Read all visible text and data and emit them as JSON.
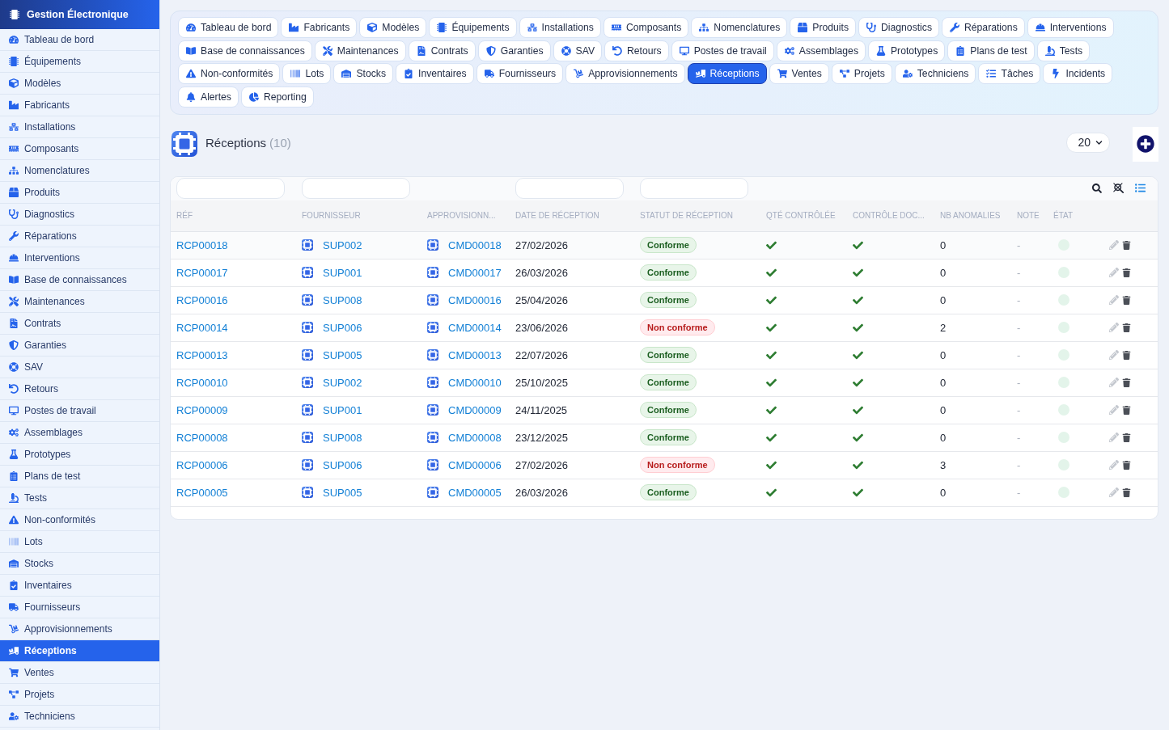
{
  "sidebar": {
    "title": "Gestion Électronique",
    "items": [
      {
        "label": "Tableau de bord",
        "selected": false
      },
      {
        "label": "Équipements",
        "selected": false
      },
      {
        "label": "Modèles",
        "selected": false
      },
      {
        "label": "Fabricants",
        "selected": false
      },
      {
        "label": "Installations",
        "selected": false
      },
      {
        "label": "Composants",
        "selected": false
      },
      {
        "label": "Nomenclatures",
        "selected": false
      },
      {
        "label": "Produits",
        "selected": false
      },
      {
        "label": "Diagnostics",
        "selected": false
      },
      {
        "label": "Réparations",
        "selected": false
      },
      {
        "label": "Interventions",
        "selected": false
      },
      {
        "label": "Base de connaissances",
        "selected": false
      },
      {
        "label": "Maintenances",
        "selected": false
      },
      {
        "label": "Contrats",
        "selected": false
      },
      {
        "label": "Garanties",
        "selected": false
      },
      {
        "label": "SAV",
        "selected": false
      },
      {
        "label": "Retours",
        "selected": false
      },
      {
        "label": "Postes de travail",
        "selected": false
      },
      {
        "label": "Assemblages",
        "selected": false
      },
      {
        "label": "Prototypes",
        "selected": false
      },
      {
        "label": "Plans de test",
        "selected": false
      },
      {
        "label": "Tests",
        "selected": false
      },
      {
        "label": "Non-conformités",
        "selected": false
      },
      {
        "label": "Lots",
        "selected": false
      },
      {
        "label": "Stocks",
        "selected": false
      },
      {
        "label": "Inventaires",
        "selected": false
      },
      {
        "label": "Fournisseurs",
        "selected": false
      },
      {
        "label": "Approvisionnements",
        "selected": false
      },
      {
        "label": "Réceptions",
        "selected": true
      },
      {
        "label": "Ventes",
        "selected": false
      },
      {
        "label": "Projets",
        "selected": false
      },
      {
        "label": "Techniciens",
        "selected": false
      }
    ]
  },
  "tabs": {
    "rows": [
      [
        {
          "label": "Tableau de bord",
          "selected": false
        },
        {
          "label": "Fabricants",
          "selected": false
        },
        {
          "label": "Modèles",
          "selected": false
        },
        {
          "label": "Équipements",
          "selected": false
        },
        {
          "label": "Installations",
          "selected": false
        },
        {
          "label": "Composants",
          "selected": false
        },
        {
          "label": "Nomenclatures",
          "selected": false
        },
        {
          "label": "Produits",
          "selected": false
        },
        {
          "label": "Diagnostics",
          "selected": false
        },
        {
          "label": "Réparations",
          "selected": false
        },
        {
          "label": "Interventions",
          "selected": false
        }
      ],
      [
        {
          "label": "Base de connaissances",
          "selected": false
        },
        {
          "label": "Maintenances",
          "selected": false
        },
        {
          "label": "Contrats",
          "selected": false
        },
        {
          "label": "Garanties",
          "selected": false
        },
        {
          "label": "SAV",
          "selected": false
        },
        {
          "label": "Retours",
          "selected": false
        },
        {
          "label": "Postes de travail",
          "selected": false
        },
        {
          "label": "Assemblages",
          "selected": false
        },
        {
          "label": "Prototypes",
          "selected": false
        },
        {
          "label": "Plans de test",
          "selected": false
        },
        {
          "label": "Tests",
          "selected": false
        }
      ],
      [
        {
          "label": "Non-conformités",
          "selected": false
        },
        {
          "label": "Lots",
          "selected": false
        },
        {
          "label": "Stocks",
          "selected": false
        },
        {
          "label": "Inventaires",
          "selected": false
        },
        {
          "label": "Fournisseurs",
          "selected": false
        },
        {
          "label": "Approvisionnements",
          "selected": false
        },
        {
          "label": "Réceptions",
          "selected": true
        },
        {
          "label": "Ventes",
          "selected": false
        },
        {
          "label": "Projets",
          "selected": false
        },
        {
          "label": "Techniciens",
          "selected": false
        },
        {
          "label": "Tâches",
          "selected": false
        },
        {
          "label": "Incidents",
          "selected": false
        }
      ],
      [
        {
          "label": "Alertes",
          "selected": false
        },
        {
          "label": "Reporting",
          "selected": false
        }
      ]
    ]
  },
  "page": {
    "title": "Réceptions",
    "count": "(10)",
    "page_size": "20"
  },
  "table": {
    "columns": [
      {
        "label": "RÉF",
        "filter": true
      },
      {
        "label": "FOURNISSEUR",
        "filter": true
      },
      {
        "label": "APPROVISIONN...",
        "filter": false
      },
      {
        "label": "DATE DE RÉCEPTION",
        "filter": true
      },
      {
        "label": "STATUT DE RÉCEPTION",
        "filter": true
      },
      {
        "label": "QTÉ CONTRÔLÉE",
        "filter": false
      },
      {
        "label": "CONTRÔLE DOC...",
        "filter": false
      },
      {
        "label": "NB ANOMALIES",
        "filter": false
      },
      {
        "label": "NOTE",
        "filter": false
      },
      {
        "label": "ÉTAT",
        "filter": false
      }
    ],
    "rows": [
      {
        "ref": "RCP00018",
        "supplier": "SUP002",
        "order": "CMD00018",
        "date": "27/02/2026",
        "status": {
          "label": "Conforme",
          "kind": "ok"
        },
        "qty_checked": true,
        "doc_checked": true,
        "anomalies": "0",
        "note": "-"
      },
      {
        "ref": "RCP00017",
        "supplier": "SUP001",
        "order": "CMD00017",
        "date": "26/03/2026",
        "status": {
          "label": "Conforme",
          "kind": "ok"
        },
        "qty_checked": true,
        "doc_checked": true,
        "anomalies": "0",
        "note": "-"
      },
      {
        "ref": "RCP00016",
        "supplier": "SUP008",
        "order": "CMD00016",
        "date": "25/04/2026",
        "status": {
          "label": "Conforme",
          "kind": "ok"
        },
        "qty_checked": true,
        "doc_checked": true,
        "anomalies": "0",
        "note": "-"
      },
      {
        "ref": "RCP00014",
        "supplier": "SUP006",
        "order": "CMD00014",
        "date": "23/06/2026",
        "status": {
          "label": "Non conforme",
          "kind": "fail"
        },
        "qty_checked": true,
        "doc_checked": true,
        "anomalies": "2",
        "note": "-"
      },
      {
        "ref": "RCP00013",
        "supplier": "SUP005",
        "order": "CMD00013",
        "date": "22/07/2026",
        "status": {
          "label": "Conforme",
          "kind": "ok"
        },
        "qty_checked": true,
        "doc_checked": true,
        "anomalies": "0",
        "note": "-"
      },
      {
        "ref": "RCP00010",
        "supplier": "SUP002",
        "order": "CMD00010",
        "date": "25/10/2025",
        "status": {
          "label": "Conforme",
          "kind": "ok"
        },
        "qty_checked": true,
        "doc_checked": true,
        "anomalies": "0",
        "note": "-"
      },
      {
        "ref": "RCP00009",
        "supplier": "SUP001",
        "order": "CMD00009",
        "date": "24/11/2025",
        "status": {
          "label": "Conforme",
          "kind": "ok"
        },
        "qty_checked": true,
        "doc_checked": true,
        "anomalies": "0",
        "note": "-"
      },
      {
        "ref": "RCP00008",
        "supplier": "SUP008",
        "order": "CMD00008",
        "date": "23/12/2025",
        "status": {
          "label": "Conforme",
          "kind": "ok"
        },
        "qty_checked": true,
        "doc_checked": true,
        "anomalies": "0",
        "note": "-"
      },
      {
        "ref": "RCP00006",
        "supplier": "SUP006",
        "order": "CMD00006",
        "date": "27/02/2026",
        "status": {
          "label": "Non conforme",
          "kind": "fail"
        },
        "qty_checked": true,
        "doc_checked": true,
        "anomalies": "3",
        "note": "-"
      },
      {
        "ref": "RCP00005",
        "supplier": "SUP005",
        "order": "CMD00005",
        "date": "26/03/2026",
        "status": {
          "label": "Conforme",
          "kind": "ok"
        },
        "qty_checked": true,
        "doc_checked": true,
        "anomalies": "0",
        "note": "-"
      }
    ]
  }
}
